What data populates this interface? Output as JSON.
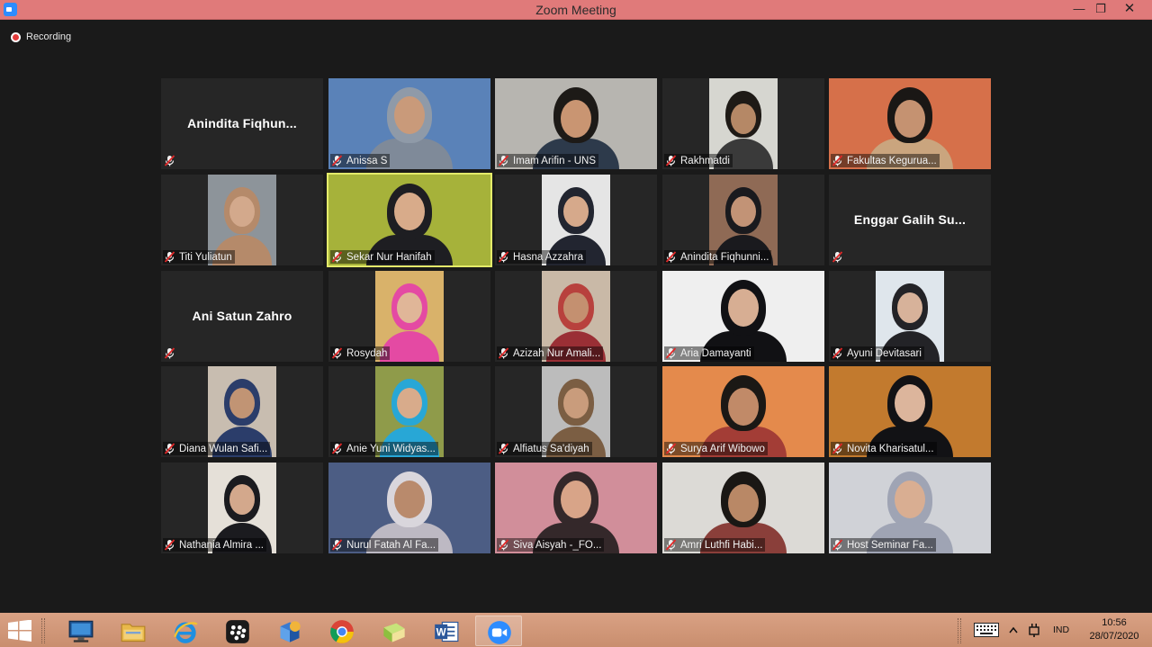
{
  "window": {
    "title": "Zoom Meeting"
  },
  "recording": {
    "label": "Recording"
  },
  "participants": [
    {
      "name": "Anindita Fiqhunni...",
      "label": "Anindita Fiqhun...",
      "video": false
    },
    {
      "name": "Anissa S",
      "video": true,
      "bg": "#5a82b8",
      "skin": "#c99a7a",
      "hijab": "#8f9aa8",
      "shirt": "#7f8a99"
    },
    {
      "name": "Imam Arifin - UNS",
      "video": true,
      "bg": "#b7b5b0",
      "skin": "#c99572",
      "hair": "#1d1a17",
      "shirt": "#2d3a4b"
    },
    {
      "name": "Rakhmatdi",
      "video": true,
      "bg": "#d6d6d0",
      "skin": "#b58866",
      "hair": "#1e1a16",
      "shirt": "#3a3a3a",
      "narrow": true
    },
    {
      "name": "Fakultas Keguruan...",
      "display": "Fakultas Kegurua...",
      "video": true,
      "bg": "#d6704a",
      "skin": "#c59271",
      "hair": "#1a1715",
      "shirt": "#caa57e"
    },
    {
      "name": "Titi Yuliatun",
      "video": true,
      "bg": "#8d949a",
      "skin": "#d3a98c",
      "hijab": "#b58a6a",
      "shirt": "#b58a6a",
      "narrow": true
    },
    {
      "name": "Sekar Nur Hanifah",
      "video": true,
      "active": true,
      "bg": "#a6b23a",
      "skin": "#d8ab8a",
      "hijab": "#1e1e22",
      "shirt": "#1e1e22"
    },
    {
      "name": "Hasna Azzahra",
      "video": true,
      "bg": "#e5e5e5",
      "skin": "#d6a98b",
      "hijab": "#222530",
      "shirt": "#222530",
      "narrow": true
    },
    {
      "name": "Anindita Fiqhunnisa",
      "display": "Anindita Fiqhunni...",
      "video": true,
      "bg": "#8f6a55",
      "skin": "#c29376",
      "hijab": "#1a1a1e",
      "shirt": "#1a1a1e",
      "narrow": true
    },
    {
      "name": "Enggar Galih Su...",
      "label": "Enggar Galih Su...",
      "video": false
    },
    {
      "name": "Ani Satun Zahro",
      "label": "Ani Satun Zahro",
      "video": false
    },
    {
      "name": "Rosydah",
      "video": true,
      "bg": "#d9b26a",
      "skin": "#e0b698",
      "hijab": "#e44aa3",
      "shirt": "#e44aa3",
      "narrow": true
    },
    {
      "name": "Azizah Nur Amalia",
      "display": "Azizah Nur Amali...",
      "video": true,
      "bg": "#c9b9a7",
      "skin": "#c49070",
      "hijab": "#b8413d",
      "shirt": "#9a2f35",
      "narrow": true
    },
    {
      "name": "Aria Damayanti",
      "video": true,
      "bg": "#efefef",
      "skin": "#d7ae93",
      "hijab": "#111114",
      "shirt": "#111114"
    },
    {
      "name": "Ayuni Devitasari",
      "video": true,
      "bg": "#dfe6ec",
      "skin": "#d7b29a",
      "hijab": "#232327",
      "shirt": "#232327",
      "narrow": true
    },
    {
      "name": "Diana Wulan Safitri",
      "display": "Diana Wulan Safi...",
      "video": true,
      "bg": "#c8bdb0",
      "skin": "#c19474",
      "hijab": "#2b3d6a",
      "shirt": "#2b3d6a",
      "narrow": true
    },
    {
      "name": "Anie Yuni Widyastuti",
      "display": "Anie Yuni Widyas...",
      "video": true,
      "bg": "#8f9b4a",
      "skin": "#d8ab8b",
      "hijab": "#28a7d6",
      "shirt": "#28a7d6",
      "narrow": true
    },
    {
      "name": "Alfiatus Sa'diyah",
      "video": true,
      "bg": "#bcbcbc",
      "skin": "#c99c7c",
      "hijab": "#7b5e43",
      "shirt": "#7b5e43",
      "narrow": true
    },
    {
      "name": "Surya Arif Wibowo",
      "video": true,
      "bg": "#e48a4c",
      "skin": "#c18a68",
      "hair": "#1b1815",
      "shirt": "#a33d36"
    },
    {
      "name": "Novita Kharisatul...",
      "video": true,
      "bg": "#c27a2e",
      "skin": "#dcb59c",
      "hijab": "#121215",
      "shirt": "#121215"
    },
    {
      "name": "Nathania Almira ...",
      "video": true,
      "bg": "#e5e0d8",
      "skin": "#d3a88c",
      "hijab": "#1b1b1f",
      "shirt": "#1b1b1f",
      "narrow": true
    },
    {
      "name": "Nurul Fatah Al Fa...",
      "video": true,
      "bg": "#4c5d84",
      "skin": "#b98a6c",
      "hijab": "#d9d6dc",
      "shirt": "#bdb9c3"
    },
    {
      "name": "Siva Aisyah -_FO...",
      "video": true,
      "bg": "#d18e9a",
      "skin": "#d8a488",
      "hijab": "#34282a",
      "shirt": "#34282a"
    },
    {
      "name": "Amri Luthfi Habi...",
      "video": true,
      "bg": "#dcdad6",
      "skin": "#b98866",
      "hair": "#1a1714",
      "shirt": "#8a3f3a"
    },
    {
      "name": "Host Seminar Fa...",
      "video": true,
      "bg": "#d0d2d7",
      "skin": "#d9ae92",
      "hijab": "#9fa4b4",
      "shirt": "#9fa4b4"
    }
  ],
  "taskbar": {
    "apps": [
      "monitor-app",
      "file-explorer",
      "internet-explorer",
      "blackberry",
      "box-app",
      "chrome",
      "folder-app",
      "word",
      "zoom"
    ],
    "open_app": "zoom",
    "language": "IND",
    "time": "10:56",
    "date": "28/07/2020"
  }
}
